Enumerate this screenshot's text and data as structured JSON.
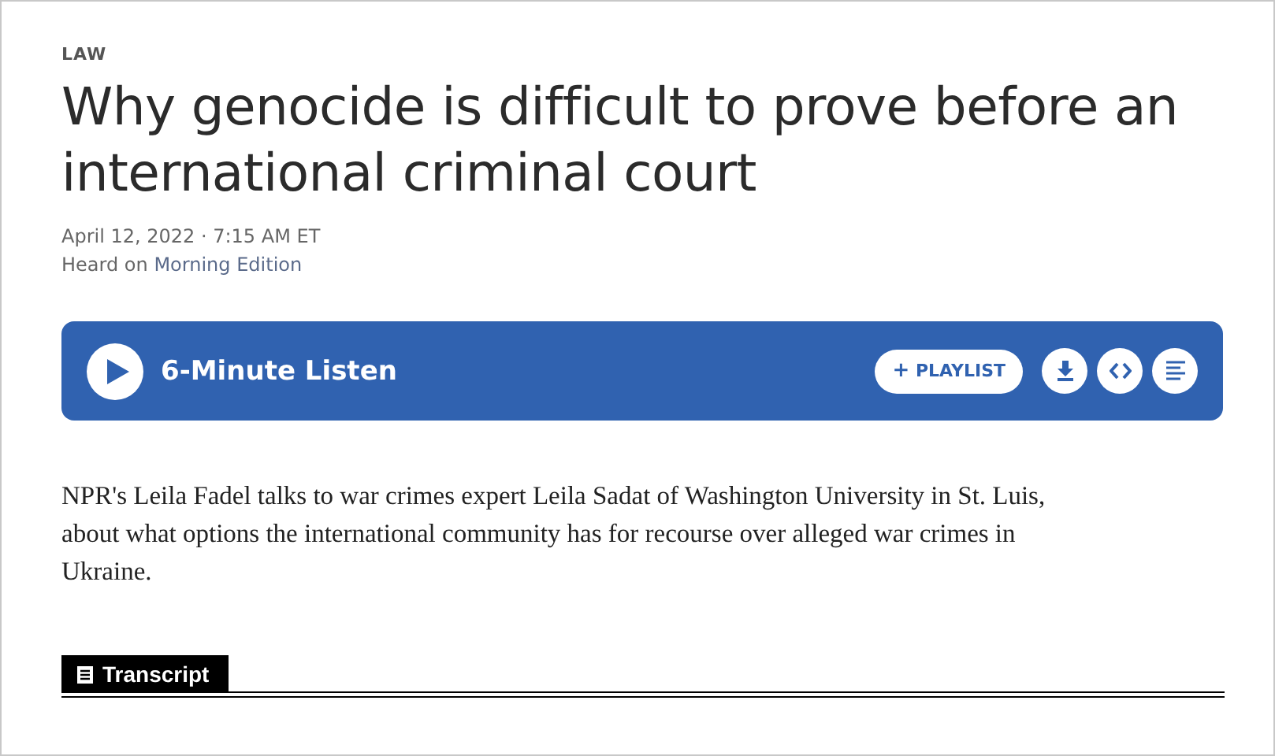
{
  "section": "LAW",
  "headline": "Why genocide is difficult to prove before an international criminal court",
  "dateline": "April 12, 2022 · 7:15 AM ET",
  "heard_on": {
    "prefix": "Heard on ",
    "program": "Morning Edition"
  },
  "player": {
    "title": "6-Minute Listen",
    "playlist_label": "PLAYLIST",
    "playlist_sign": "+"
  },
  "summary": "NPR's Leila Fadel talks to war crimes expert Leila Sadat of Washington University in St. Luis, about what options the international community has for recourse over alleged war crimes in Ukraine.",
  "transcript_tab": {
    "label": "Transcript"
  }
}
